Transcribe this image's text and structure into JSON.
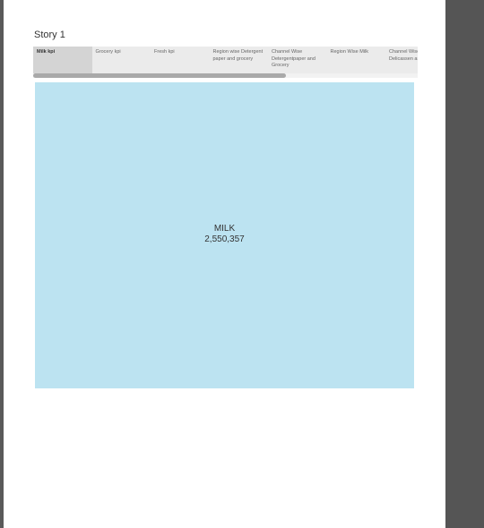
{
  "story": {
    "title": "Story 1"
  },
  "nav": {
    "tabs": [
      {
        "label": "Milk kpi",
        "active": true
      },
      {
        "label": "Grocery kpi",
        "active": false
      },
      {
        "label": "Fresh kpi",
        "active": false
      },
      {
        "label": "Region wise Detergent paper and grocery",
        "active": false
      },
      {
        "label": "Channel Wise Detergentpaper and Grocery",
        "active": false
      },
      {
        "label": "Region Wise Milk",
        "active": false
      },
      {
        "label": "Channel Wise Delicassen and Frozen",
        "active": false
      }
    ]
  },
  "kpi": {
    "label": "MILK",
    "value": "2,550,357",
    "color": "#bce3f1"
  },
  "colors": {
    "tab_active": "#d4d4d4",
    "tab_bar": "#ebebeb",
    "side_panel": "#555555"
  }
}
